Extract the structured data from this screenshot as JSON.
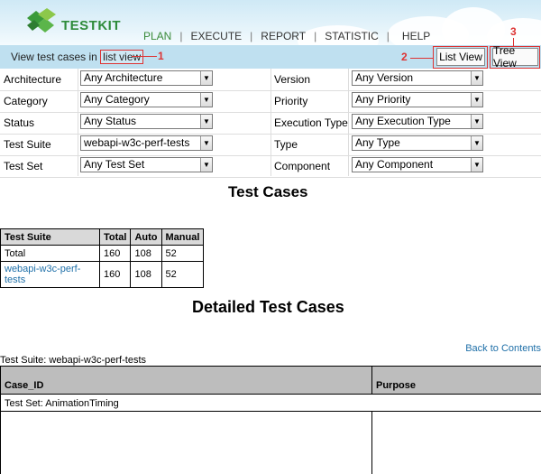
{
  "header": {
    "logo_text": "TESTKIT",
    "nav": [
      "PLAN",
      "EXECUTE",
      "REPORT",
      "STATISTIC",
      "HELP"
    ],
    "active_nav": "PLAN"
  },
  "subbar": {
    "prefix": "View test cases in ",
    "mode": "list view",
    "annotations": [
      "1",
      "2",
      "3"
    ],
    "list_view_button": "List View",
    "tree_view_button": "Tree View"
  },
  "filters": {
    "left": [
      {
        "label": "Architecture",
        "value": "Any Architecture"
      },
      {
        "label": "Category",
        "value": "Any Category"
      },
      {
        "label": "Status",
        "value": "Any Status"
      },
      {
        "label": "Test Suite",
        "value": "webapi-w3c-perf-tests"
      },
      {
        "label": "Test Set",
        "value": "Any Test Set"
      }
    ],
    "right": [
      {
        "label": "Version",
        "value": "Any Version"
      },
      {
        "label": "Priority",
        "value": "Any Priority"
      },
      {
        "label": "Execution Type",
        "value": "Any Execution Type"
      },
      {
        "label": "Type",
        "value": "Any Type"
      },
      {
        "label": "Component",
        "value": "Any Component"
      }
    ]
  },
  "test_cases_title": "Test Cases",
  "summary_table": {
    "headers": [
      "Test Suite",
      "Total",
      "Auto",
      "Manual"
    ],
    "rows": [
      [
        "Total",
        "160",
        "108",
        "52"
      ],
      [
        "webapi-w3c-perf-tests",
        "160",
        "108",
        "52"
      ]
    ]
  },
  "detailed_title": "Detailed Test Cases",
  "back_to_contents": "Back to Contents",
  "suite_label": "Test Suite: webapi-w3c-perf-tests",
  "detail_table": {
    "headers": [
      "Case_ID",
      "Purpose"
    ],
    "test_set": "Test Set: AnimationTiming"
  },
  "colors": {
    "accent_green": "#2e8b3a",
    "annotation_red": "#dd3333",
    "link_blue": "#1e6fa8",
    "subbar_blue": "#bfe0f0"
  }
}
